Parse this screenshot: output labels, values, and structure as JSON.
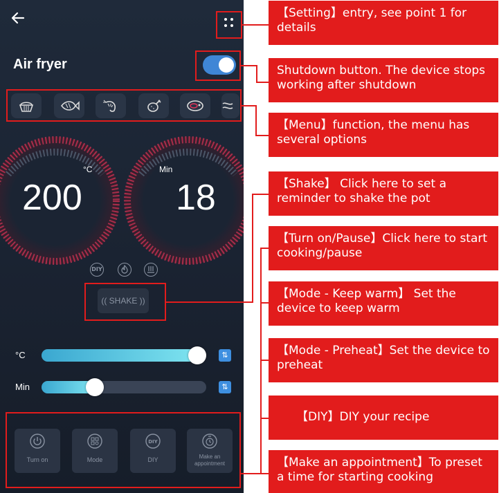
{
  "app": {
    "title": "Air fryer"
  },
  "nav": {
    "back_icon": "back-arrow-icon",
    "settings_icon": "grid-dots-icon"
  },
  "power": {
    "state": "on",
    "color": "#3f86d6"
  },
  "menu": {
    "items": [
      {
        "name": "cupcake-icon"
      },
      {
        "name": "fish-icon"
      },
      {
        "name": "shrimp-icon"
      },
      {
        "name": "drumstick-icon"
      },
      {
        "name": "steak-icon"
      },
      {
        "name": "bacon-icon"
      }
    ]
  },
  "temperature": {
    "value": "200",
    "unit": "°C"
  },
  "timer": {
    "value": "18",
    "unit": "Min"
  },
  "mini_icons": {
    "diy": "DIY",
    "flame": "flame-icon",
    "heat": "heat-icon"
  },
  "shake": {
    "label": "(( SHAKE ))"
  },
  "sliders": {
    "temp": {
      "label": "°C",
      "level": 1.0
    },
    "time": {
      "label": "Min",
      "level": 0.3
    }
  },
  "bottom_buttons": [
    {
      "label": "Turn on",
      "icon": "power-icon"
    },
    {
      "label": "Mode",
      "icon": "mode-grid-icon"
    },
    {
      "label": "DIY",
      "icon": "diy-icon"
    },
    {
      "label": "Make an appointment",
      "icon": "timer-icon"
    }
  ],
  "annotations": [
    "【Setting】entry, see point 1 for details",
    "Shutdown button. The device stops working after shutdown",
    "【Menu】function, the menu has several options",
    "【Shake】 Click here to set a reminder to shake the pot",
    "【Turn on/Pause】Click here to start cooking/pause",
    "【Mode - Keep warm】 Set the device to keep warm",
    "【Mode - Preheat】Set the device to preheat",
    "【DIY】DIY your recipe",
    "【Make an appointment】To preset a time for starting cooking"
  ],
  "colors": {
    "accent_red": "#e21c1c",
    "gauge_red": "#e8365a",
    "slider_blue": "#3aa7d0"
  }
}
